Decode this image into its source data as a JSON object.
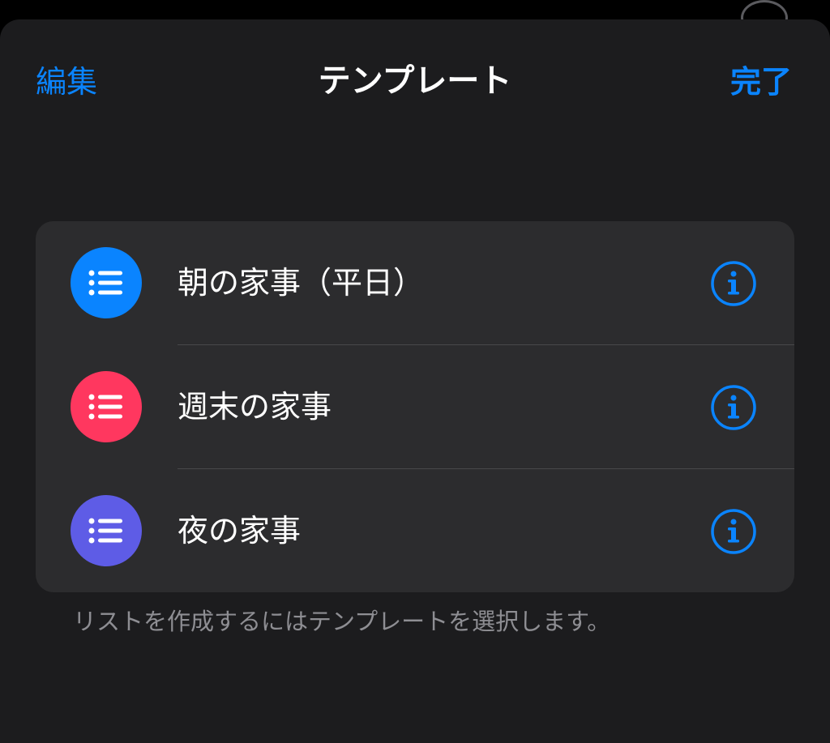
{
  "nav": {
    "edit_label": "編集",
    "title": "テンプレート",
    "done_label": "完了"
  },
  "templates": [
    {
      "label": "朝の家事（平日）",
      "icon": "list-icon",
      "color": "#0a84ff"
    },
    {
      "label": "週末の家事",
      "icon": "list-icon",
      "color": "#ff375f"
    },
    {
      "label": "夜の家事",
      "icon": "list-icon",
      "color": "#5e5ce6"
    }
  ],
  "footer": {
    "hint": "リストを作成するにはテンプレートを選択します。"
  },
  "colors": {
    "accent": "#0a84ff",
    "sheet_bg": "#1c1c1e",
    "card_bg": "#2c2c2e"
  }
}
